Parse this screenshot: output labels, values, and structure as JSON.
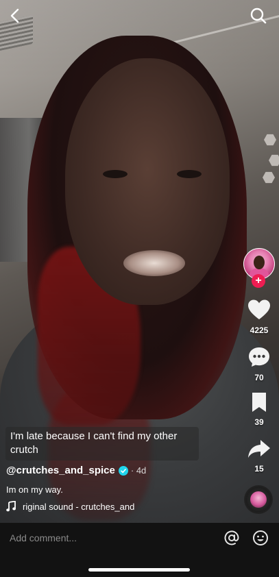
{
  "top_bar": {
    "back_icon": "chevron-left-icon",
    "search_icon": "search-icon"
  },
  "actions": {
    "follow_icon": "plus-icon",
    "like": {
      "icon": "heart-icon",
      "count": "4225"
    },
    "comments": {
      "icon": "comment-bubble-icon",
      "count": "70"
    },
    "favorites": {
      "icon": "bookmark-icon",
      "count": "39"
    },
    "share": {
      "icon": "share-arrow-icon",
      "count": "15"
    },
    "sound_disc_icon": "music-disc-icon"
  },
  "video": {
    "overlay_caption": "I'm late because I can't find my other crutch"
  },
  "post": {
    "username": "@crutches_and_spice",
    "verified_icon": "verified-badge-icon",
    "age": "· 4d",
    "description": "Im on my way.",
    "sound_icon": "music-note-icon",
    "sound_name": "riginal sound - crutches_and"
  },
  "comment_bar": {
    "placeholder": "Add comment...",
    "mention_icon": "at-sign-icon",
    "emoji_icon": "emoji-icon"
  },
  "colors": {
    "follow": "#ee1d52",
    "verified": "#20d5ec",
    "bar_bg": "#121212"
  }
}
